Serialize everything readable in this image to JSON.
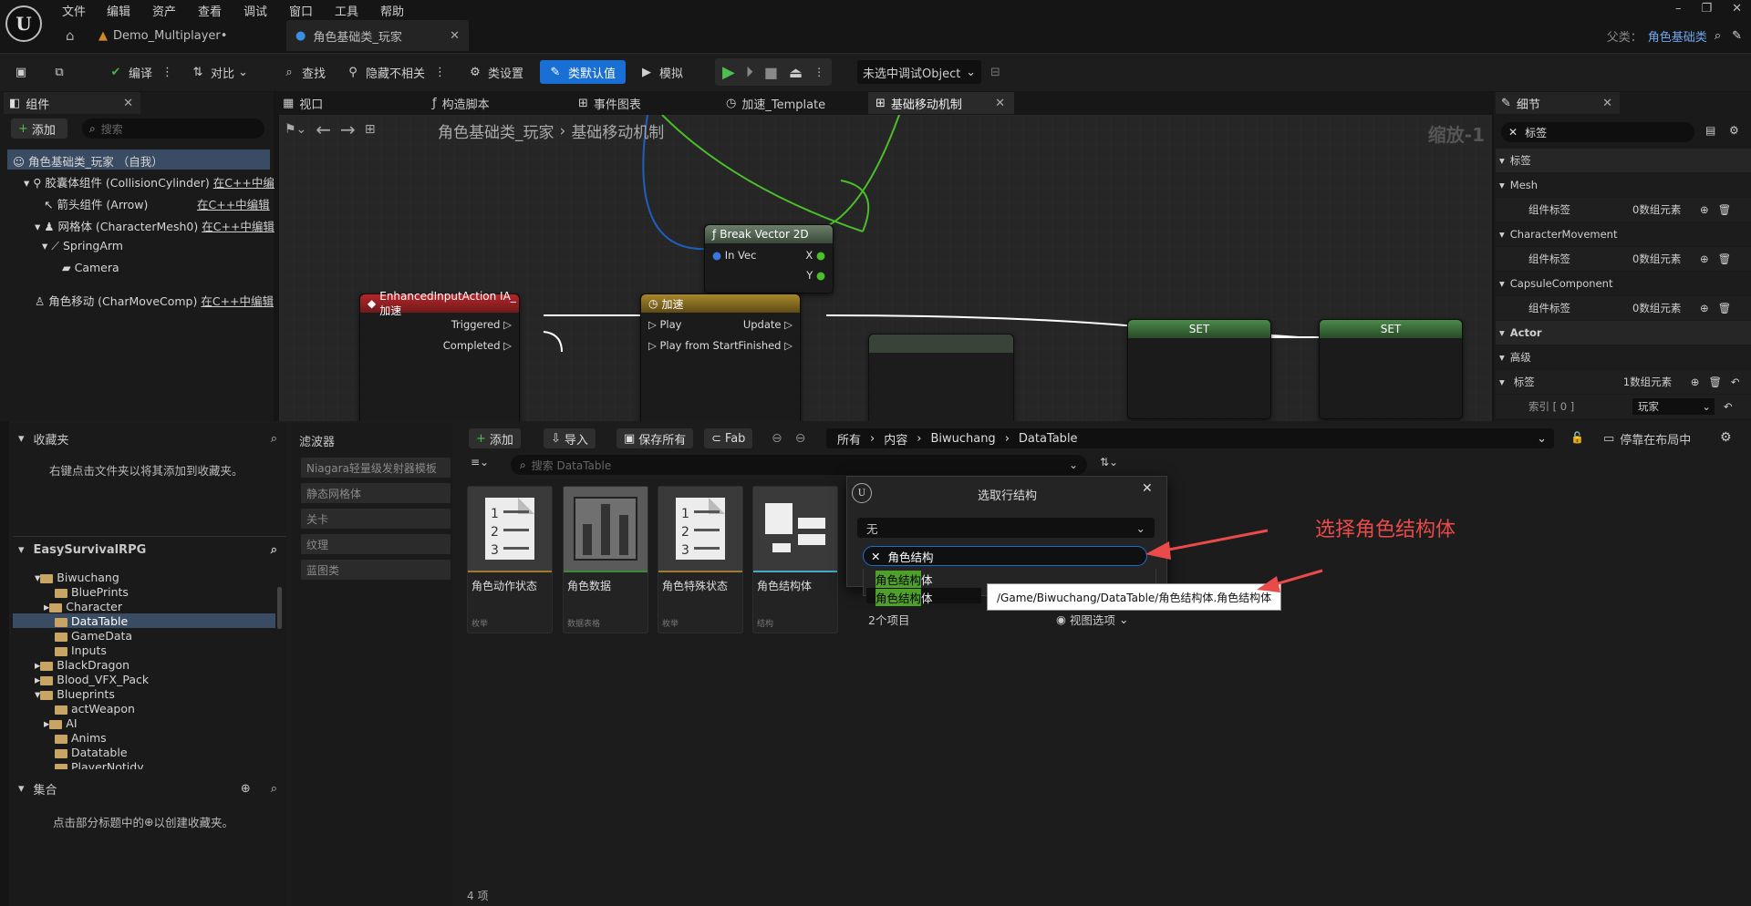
{
  "menubar": {
    "items": [
      "文件",
      "编辑",
      "资产",
      "查看",
      "调试",
      "窗口",
      "工具",
      "帮助"
    ]
  },
  "tabs": {
    "project": "Demo_Multiplayer•",
    "active": "角色基础类_玩家",
    "parent_label": "父类：",
    "parent_value": "角色基础类"
  },
  "toolbar": {
    "compile": "编译",
    "diff": "对比",
    "find": "查找",
    "hide": "隐藏不相关",
    "class_settings": "类设置",
    "class_defaults": "类默认值",
    "simulate": "模拟",
    "debug_object": "未选中调试Object"
  },
  "components": {
    "tab": "组件",
    "add": "添加",
    "search_placeholder": "搜索",
    "root": "角色基础类_玩家 （自我）",
    "items": [
      {
        "label": "胶囊体组件 (CollisionCylinder)",
        "edit": "在C++中编"
      },
      {
        "label": "箭头组件 (Arrow)",
        "edit": "在C++中编辑"
      },
      {
        "label": "网格体 (CharacterMesh0)",
        "edit": "在C++中编辑"
      },
      {
        "label": "SpringArm",
        "edit": ""
      },
      {
        "label": "Camera",
        "edit": ""
      },
      {
        "label": "角色移动 (CharMoveComp)",
        "edit": "在C++中编辑"
      }
    ]
  },
  "editor_tabs": [
    "视口",
    "构造脚本",
    "事件图表",
    "加速_Template",
    "基础移动机制"
  ],
  "graph": {
    "breadcrumb_root": "角色基础类_玩家",
    "breadcrumb_leaf": "基础移动机制",
    "zoom": "缩放-1",
    "nodes": {
      "break": {
        "title": "Break Vector 2D",
        "in": "In Vec",
        "x": "X",
        "y": "Y"
      },
      "input": {
        "title": "EnhancedInputAction IA_加速",
        "triggered": "Triggered",
        "completed": "Completed"
      },
      "timeline": {
        "title": "加速",
        "play": "Play",
        "play_start": "Play from Start",
        "update": "Update",
        "finished": "Finished"
      },
      "set1": "SET",
      "set2": "SET"
    }
  },
  "details": {
    "tab": "细节",
    "search_value": "标签",
    "rows": [
      {
        "label": "标签",
        "kind": "section"
      },
      {
        "label": "Mesh",
        "kind": "sub"
      },
      {
        "label": "组件标签",
        "value": "0数组元素",
        "kind": "prop"
      },
      {
        "label": "CharacterMovement",
        "kind": "sub"
      },
      {
        "label": "组件标签",
        "value": "0数组元素",
        "kind": "prop"
      },
      {
        "label": "CapsuleComponent",
        "kind": "sub"
      },
      {
        "label": "组件标签",
        "value": "0数组元素",
        "kind": "prop"
      },
      {
        "label": "Actor",
        "kind": "section"
      },
      {
        "label": "高级",
        "kind": "sub"
      },
      {
        "label": "标签",
        "value": "1数组元素",
        "kind": "prop"
      },
      {
        "label": "索引 [ 0 ]",
        "value": "玩家",
        "kind": "index"
      }
    ]
  },
  "browser": {
    "favorites": "收藏夹",
    "favorites_hint": "右键点击文件夹以将其添加到收藏夹。",
    "project": "EasySurvivalRPG",
    "folders": [
      "Biwuchang",
      "BluePrints",
      "Character",
      "DataTable",
      "GameData",
      "Inputs",
      "BlackDragon",
      "Blood_VFX_Pack",
      "Blueprints",
      "actWeapon",
      "AI",
      "Anims",
      "Datatable",
      "PlayerNotidy"
    ],
    "collections": "集合",
    "collections_hint_a": "点击部分标题中的",
    "collections_hint_b": "以创建收藏夹。",
    "filters_title": "滤波器",
    "filters": [
      "Niagara轻量级发射器模板",
      "静态网格体",
      "关卡",
      "纹理",
      "蓝图类"
    ],
    "add": "添加",
    "import": "导入",
    "save_all": "保存所有",
    "fab": "Fab",
    "path": [
      "所有",
      "内容",
      "Biwuchang",
      "DataTable"
    ],
    "dock": "停靠在布局中",
    "search_placeholder": "搜索 DataTable",
    "assets": [
      {
        "name": "角色动作状态",
        "type": "枚举"
      },
      {
        "name": "角色数据",
        "type": "数据表格"
      },
      {
        "name": "角色特殊状态",
        "type": "枚举"
      },
      {
        "name": "角色结构体",
        "type": "结构"
      }
    ],
    "count": "4 项"
  },
  "picker": {
    "title": "选取行结构",
    "selected": "无",
    "search": "角色结构",
    "results": [
      {
        "match": "角色结构",
        "rest": "体"
      },
      {
        "match": "角色结构",
        "rest": "体"
      }
    ],
    "count": "2个项目",
    "view": "视图选项",
    "tooltip": "/Game/Biwuchang/DataTable/角色结构体.角色结构体"
  },
  "annotation": "选择角色结构体",
  "colors": {
    "accent": "#1a6fd4",
    "annotation": "#ea4a4a",
    "exec_green": "#3c7a3c"
  }
}
